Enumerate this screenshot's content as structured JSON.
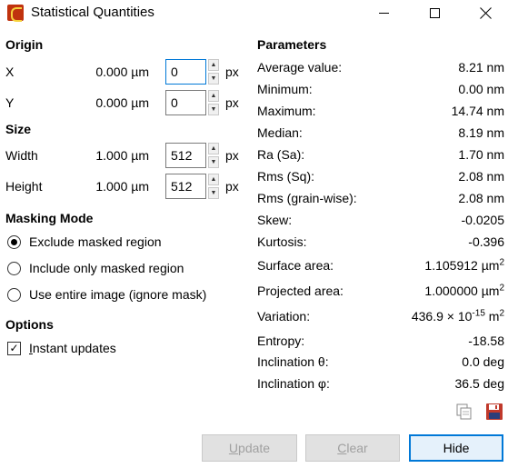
{
  "window": {
    "title": "Statistical Quantities"
  },
  "origin": {
    "heading": "Origin",
    "x": {
      "label": "X",
      "value": "0.000 µm",
      "px": "0",
      "unit": "px"
    },
    "y": {
      "label": "Y",
      "value": "0.000 µm",
      "px": "0",
      "unit": "px"
    }
  },
  "size": {
    "heading": "Size",
    "width": {
      "label": "Width",
      "value": "1.000 µm",
      "px": "512",
      "unit": "px"
    },
    "height": {
      "label": "Height",
      "value": "1.000 µm",
      "px": "512",
      "unit": "px"
    }
  },
  "masking": {
    "heading": "Masking Mode",
    "options": [
      {
        "label": "Exclude masked region",
        "selected": true
      },
      {
        "label": "Include only masked region",
        "selected": false
      },
      {
        "label": "Use entire image (ignore mask)",
        "selected": false
      }
    ]
  },
  "options": {
    "heading": "Options",
    "instant_updates": {
      "label": "Instant updates",
      "mnemonic": "I",
      "rest": "nstant updates",
      "checked": true
    }
  },
  "parameters": {
    "heading": "Parameters",
    "items": [
      {
        "name": "Average value:",
        "value": "8.21 nm"
      },
      {
        "name": "Minimum:",
        "value": "0.00 nm"
      },
      {
        "name": "Maximum:",
        "value": "14.74 nm"
      },
      {
        "name": "Median:",
        "value": "8.19 nm"
      },
      {
        "name": "Ra (Sa):",
        "value": "1.70 nm"
      },
      {
        "name": "Rms (Sq):",
        "value": "2.08 nm"
      },
      {
        "name": "Rms (grain-wise):",
        "value": "2.08 nm"
      },
      {
        "name": "Skew:",
        "value": "-0.0205"
      },
      {
        "name": "Kurtosis:",
        "value": "-0.396"
      },
      {
        "name": "Surface area:",
        "value": "1.105912 µm",
        "sup": "2"
      },
      {
        "name": "Projected area:",
        "value": "1.000000 µm",
        "sup": "2"
      },
      {
        "name": "Variation:",
        "value": "436.9 × 10",
        "sup": "-15",
        "suffix": " m",
        "sup2": "2"
      },
      {
        "name": "Entropy:",
        "value": "-18.58"
      },
      {
        "name": "Inclination θ:",
        "value": "0.0 deg"
      },
      {
        "name": "Inclination φ:",
        "value": "36.5 deg"
      }
    ]
  },
  "buttons": {
    "update": {
      "mnemonic": "U",
      "rest": "pdate"
    },
    "clear": {
      "mnemonic": "C",
      "rest": "lear"
    },
    "hide": "Hide"
  },
  "icons": {
    "app": "gwyddion-app-icon",
    "copy": "copy-icon",
    "save": "save-icon"
  },
  "colors": {
    "accent": "#0078d7",
    "disabled_text": "#a0a0a0",
    "save_red": "#c0392b"
  }
}
